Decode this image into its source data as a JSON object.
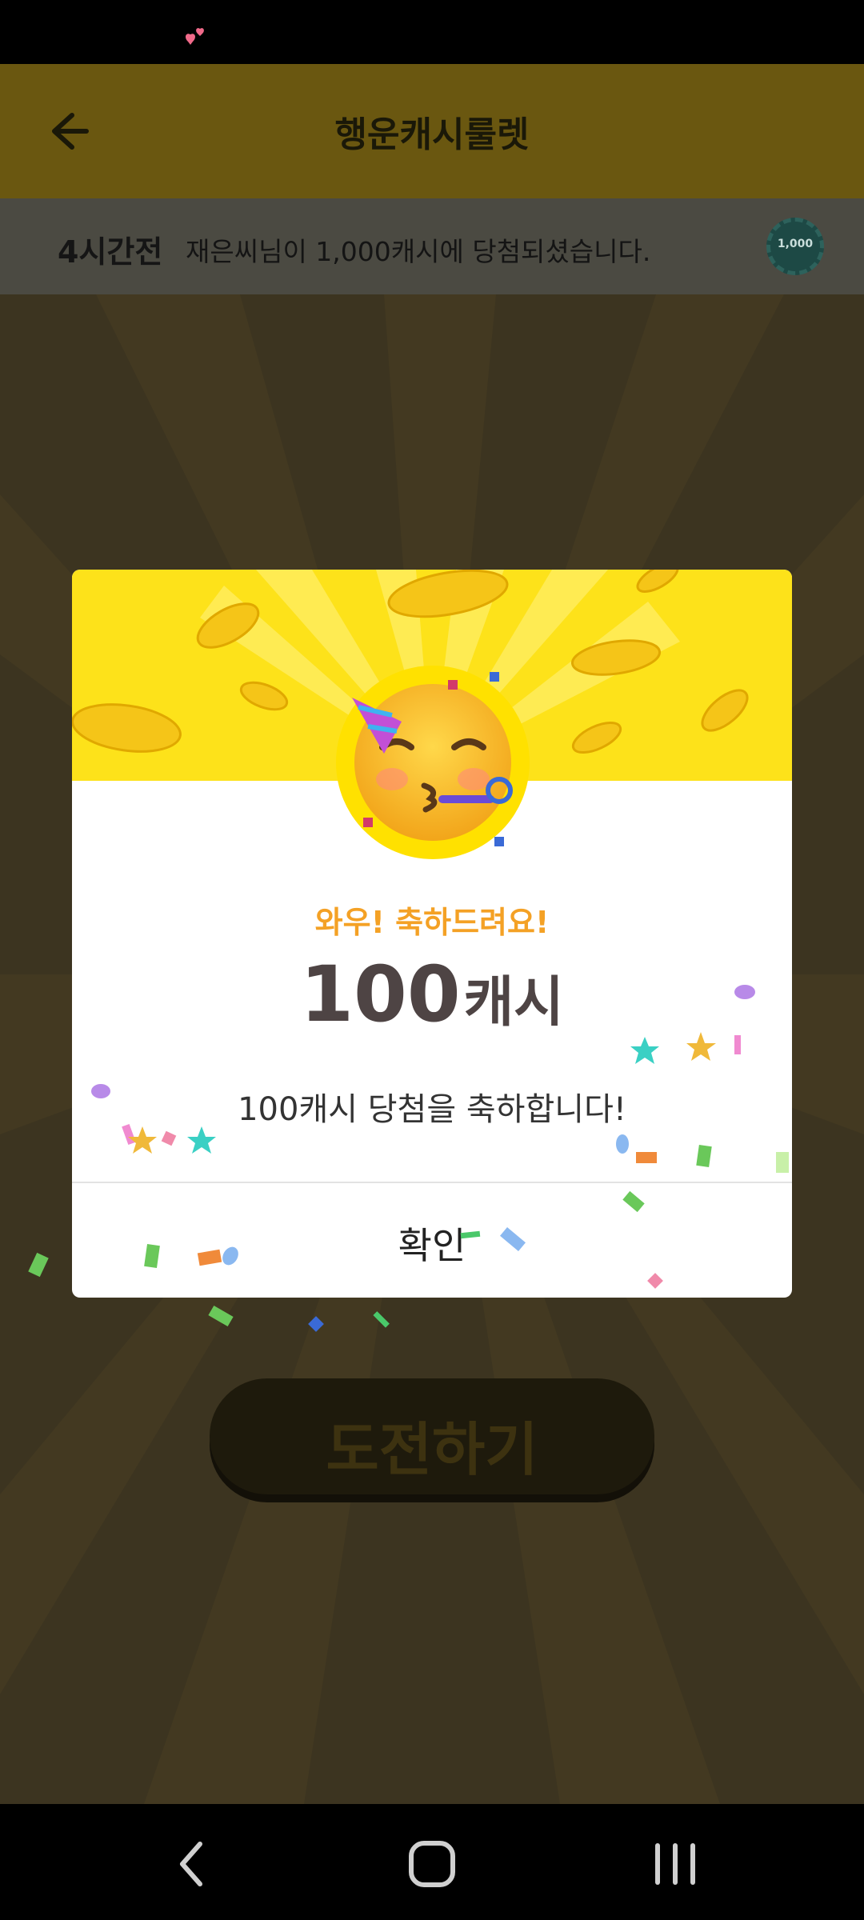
{
  "header": {
    "title": "행운캐시룰렛"
  },
  "ticker": {
    "time": "4시간전",
    "message": "재은씨님이 1,000캐시에 당첨되셨습니다.",
    "chip_label": "1,000"
  },
  "main": {
    "challenge_label": "도전하기"
  },
  "dialog": {
    "subtitle": "와우! 축하드려요!",
    "amount_number": "100",
    "amount_unit": "캐시",
    "message": "100캐시 당첨을 축하합니다!",
    "confirm_label": "확인"
  },
  "colors": {
    "accent": "#f4a125",
    "header_yellow": "#fde21a",
    "text_dark": "#4e4444"
  },
  "icons": {
    "back": "arrow-left-icon",
    "chip": "coin-chip-icon",
    "emoji": "partying-face-icon",
    "nav_back": "chevron-left-icon",
    "nav_home": "home-square-icon",
    "nav_recents": "recents-icon"
  }
}
